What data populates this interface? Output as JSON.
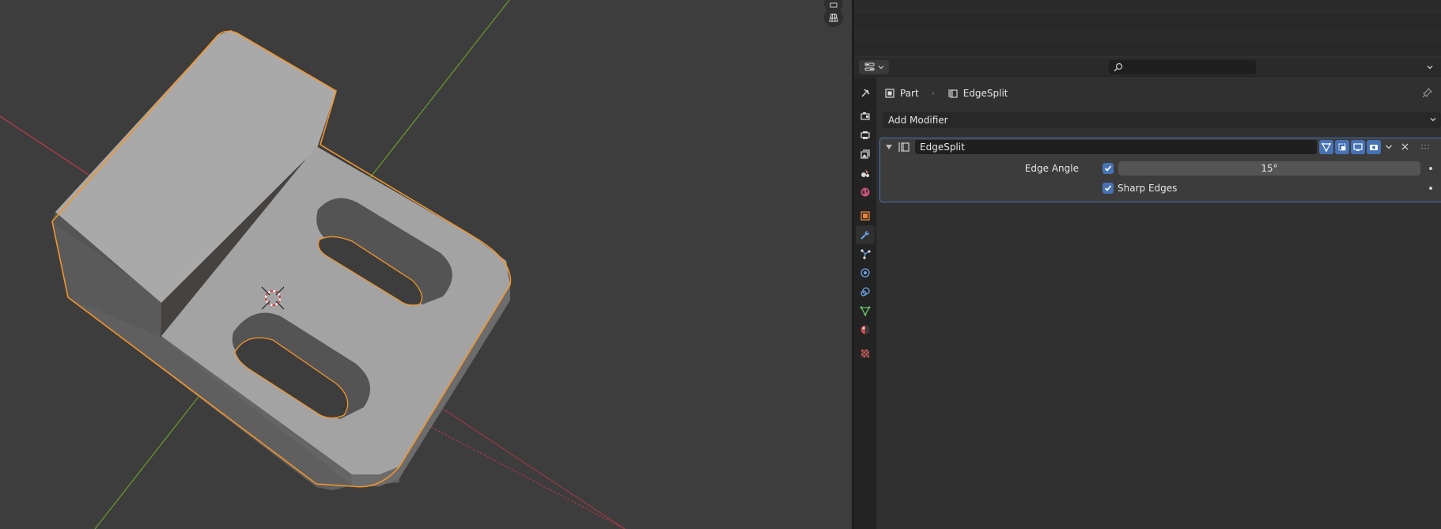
{
  "properties": {
    "search": {
      "placeholder": "",
      "value": ""
    },
    "breadcrumb": {
      "object": "Part",
      "modifier": "EdgeSplit"
    },
    "add_modifier_label": "Add Modifier",
    "modifier": {
      "name": "EdgeSplit",
      "edge_angle": {
        "label": "Edge Angle",
        "enabled": true,
        "value": "15°"
      },
      "sharp_edges": {
        "label": "Sharp Edges",
        "enabled": true
      }
    },
    "tabs": [
      "tool-icon",
      "render-icon",
      "output-icon",
      "view-layer-icon",
      "scene-icon",
      "world-icon",
      "object-icon",
      "modifier-icon",
      "particles-icon",
      "physics-icon",
      "constraints-icon",
      "data-icon",
      "material-icon",
      "texture-icon"
    ],
    "active_tab": "modifier-icon"
  },
  "colors": {
    "accent": "#4772b3",
    "selection_outline": "#f2952c",
    "x_axis": "#b33a4a",
    "y_axis": "#6a9d2a"
  }
}
